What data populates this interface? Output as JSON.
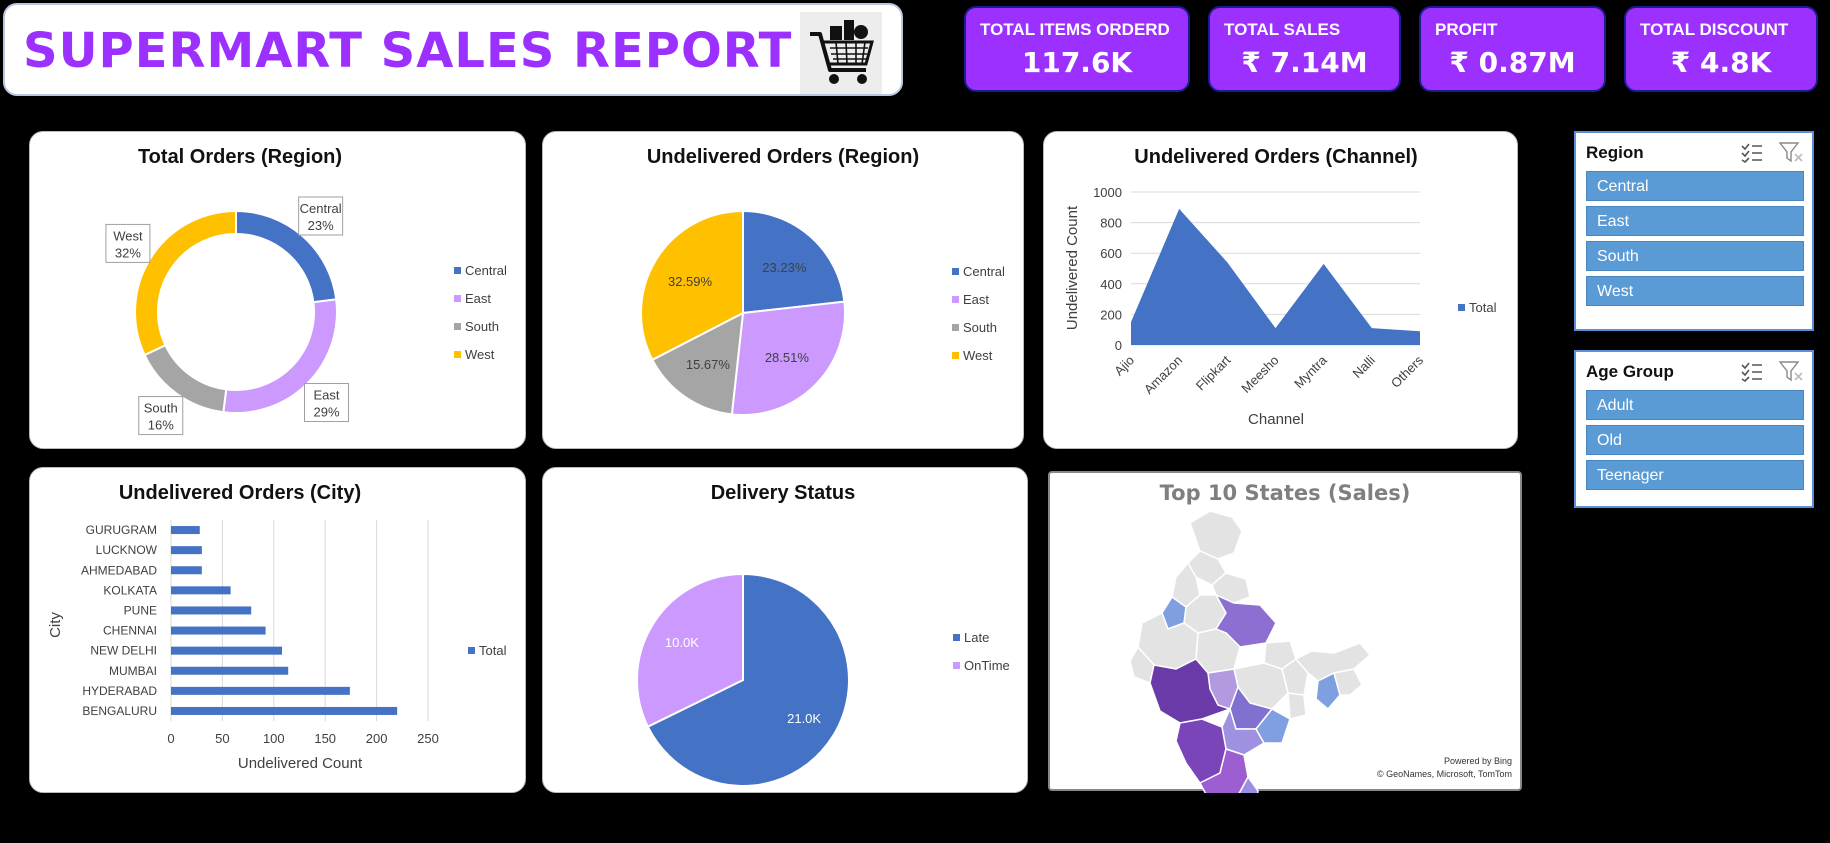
{
  "header": {
    "title": "SUPERMART SALES REPORT",
    "cart_icon": "shopping-cart-icon"
  },
  "kpis": [
    {
      "label": "TOTAL ITEMS ORDERD",
      "value": "117.6K"
    },
    {
      "label": "TOTAL SALES",
      "value": "₹ 7.14M"
    },
    {
      "label": "PROFIT",
      "value": "₹ 0.87M"
    },
    {
      "label": "TOTAL DISCOUNT",
      "value": "₹ 4.8K"
    }
  ],
  "colors": {
    "blue": "#4472C4",
    "lavender": "#CC99FF",
    "gray": "#A5A5A5",
    "gold": "#FFC000",
    "kpi": "#9B30FF",
    "title": "#9B30FF"
  },
  "slicers": {
    "region": {
      "title": "Region",
      "items": [
        "Central",
        "East",
        "South",
        "West"
      ]
    },
    "age": {
      "title": "Age Group",
      "items": [
        "Adult",
        "Old",
        "Teenager"
      ]
    }
  },
  "chart_data": [
    {
      "type": "pie",
      "variant": "donut",
      "title": "Total Orders (Region)",
      "labels": [
        "Central",
        "East",
        "South",
        "West"
      ],
      "values": [
        23,
        29,
        16,
        32
      ],
      "data_labels": [
        [
          "Central",
          "23%"
        ],
        [
          "East",
          "29%"
        ],
        [
          "South",
          "16%"
        ],
        [
          "West",
          "32%"
        ]
      ],
      "legend": "right"
    },
    {
      "type": "pie",
      "title": "Undelivered Orders (Region)",
      "labels": [
        "Central",
        "East",
        "South",
        "West"
      ],
      "values": [
        23.23,
        28.51,
        15.67,
        32.59
      ],
      "data_labels": [
        "23.23%",
        "28.51%",
        "15.67%",
        "32.59%"
      ],
      "legend": "right"
    },
    {
      "type": "area",
      "title": "Undelivered Orders (Channel)",
      "categories": [
        "Ajio",
        "Amazon",
        "Flipkart",
        "Meesho",
        "Myntra",
        "Nalli",
        "Others"
      ],
      "series": [
        {
          "name": "Total",
          "values": [
            150,
            890,
            540,
            110,
            530,
            110,
            90
          ]
        }
      ],
      "xlabel": "Channel",
      "ylabel": "Undelivered Count",
      "ylim": [
        0,
        1000
      ],
      "yticks": [
        "0",
        "200",
        "400",
        "600",
        "800",
        "1000"
      ],
      "grid": true,
      "legend": "right"
    },
    {
      "type": "bar",
      "orientation": "horizontal",
      "title": "Undelivered Orders (City)",
      "categories": [
        "GURUGRAM",
        "LUCKNOW",
        "AHMEDABAD",
        "KOLKATA",
        "PUNE",
        "CHENNAI",
        "NEW DELHI",
        "MUMBAI",
        "HYDERABAD",
        "BENGALURU"
      ],
      "series": [
        {
          "name": "Total",
          "values": [
            28,
            30,
            30,
            58,
            78,
            92,
            108,
            114,
            174,
            220
          ]
        }
      ],
      "xlabel": "Undelivered Count",
      "ylabel": "City",
      "xlim": [
        0,
        250
      ],
      "xticks": [
        "0",
        "50",
        "100",
        "150",
        "200",
        "250"
      ],
      "grid": true,
      "legend": "right"
    },
    {
      "type": "pie",
      "title": "Delivery Status",
      "labels": [
        "Late",
        "OnTime"
      ],
      "values": [
        21.0,
        10.0
      ],
      "data_labels": [
        "21.0K",
        "10.0K"
      ],
      "legend": "right"
    }
  ],
  "map": {
    "title": "Top 10 States (Sales)",
    "credit1": "Powered by Bing",
    "credit2": "© GeoNames, Microsoft, TomTom"
  }
}
